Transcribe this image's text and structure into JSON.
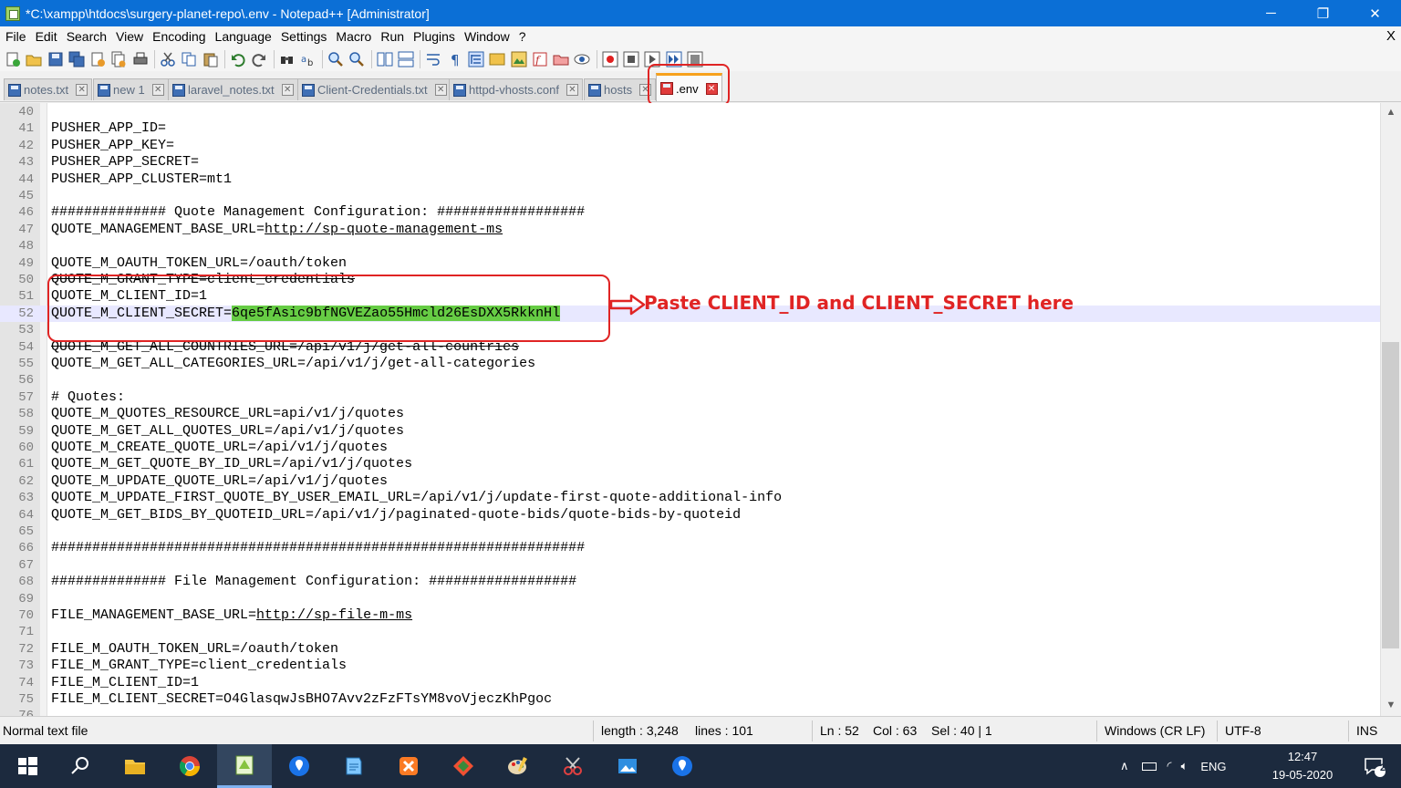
{
  "window": {
    "title": "*C:\\xampp\\htdocs\\surgery-planet-repo\\.env - Notepad++ [Administrator]",
    "minimize": "─",
    "maximize": "❐",
    "close": "✕"
  },
  "menu": {
    "items": [
      "File",
      "Edit",
      "Search",
      "View",
      "Encoding",
      "Language",
      "Settings",
      "Macro",
      "Run",
      "Plugins",
      "Window",
      "?"
    ],
    "close_label": "X"
  },
  "tabs": [
    {
      "label": "notes.txt",
      "active": false
    },
    {
      "label": "new 1",
      "active": false
    },
    {
      "label": "laravel_notes.txt",
      "active": false
    },
    {
      "label": "Client-Credentials.txt",
      "active": false
    },
    {
      "label": "httpd-vhosts.conf",
      "active": false
    },
    {
      "label": "hosts",
      "active": false
    },
    {
      "label": ".env",
      "active": true
    }
  ],
  "tab_close_glyph": "✕",
  "editor": {
    "lines": [
      {
        "n": "40",
        "text": ""
      },
      {
        "n": "41",
        "text": "PUSHER_APP_ID="
      },
      {
        "n": "42",
        "text": "PUSHER_APP_KEY="
      },
      {
        "n": "43",
        "text": "PUSHER_APP_SECRET="
      },
      {
        "n": "44",
        "text": "PUSHER_APP_CLUSTER=mt1"
      },
      {
        "n": "45",
        "text": ""
      },
      {
        "n": "46",
        "text": "############## Quote Management Configuration: ##################"
      },
      {
        "n": "47",
        "text": "QUOTE_MANAGEMENT_BASE_URL=",
        "url": "http://sp-quote-management-ms"
      },
      {
        "n": "48",
        "text": ""
      },
      {
        "n": "49",
        "text": "QUOTE_M_OAUTH_TOKEN_URL=/oauth/token"
      },
      {
        "n": "50",
        "text": "QUOTE_M_GRANT_TYPE=client_credentials",
        "strike": true
      },
      {
        "n": "51",
        "text": "QUOTE_M_CLIENT_ID=1"
      },
      {
        "n": "52",
        "text": "QUOTE_M_CLIENT_SECRET=",
        "selected": "6qe5fAsic9bfNGVEZao55Hmcld26EsDXX5RkknHl",
        "current": true
      },
      {
        "n": "53",
        "text": ""
      },
      {
        "n": "54",
        "text": "QUOTE_M_GET_ALL_COUNTRIES_URL=/api/v1/j/get-all-countries",
        "strike": true
      },
      {
        "n": "55",
        "text": "QUOTE_M_GET_ALL_CATEGORIES_URL=/api/v1/j/get-all-categories"
      },
      {
        "n": "56",
        "text": ""
      },
      {
        "n": "57",
        "text": "# Quotes:"
      },
      {
        "n": "58",
        "text": "QUOTE_M_QUOTES_RESOURCE_URL=api/v1/j/quotes"
      },
      {
        "n": "59",
        "text": "QUOTE_M_GET_ALL_QUOTES_URL=/api/v1/j/quotes"
      },
      {
        "n": "60",
        "text": "QUOTE_M_CREATE_QUOTE_URL=/api/v1/j/quotes"
      },
      {
        "n": "61",
        "text": "QUOTE_M_GET_QUOTE_BY_ID_URL=/api/v1/j/quotes"
      },
      {
        "n": "62",
        "text": "QUOTE_M_UPDATE_QUOTE_URL=/api/v1/j/quotes"
      },
      {
        "n": "63",
        "text": "QUOTE_M_UPDATE_FIRST_QUOTE_BY_USER_EMAIL_URL=/api/v1/j/update-first-quote-additional-info"
      },
      {
        "n": "64",
        "text": "QUOTE_M_GET_BIDS_BY_QUOTEID_URL=/api/v1/j/paginated-quote-bids/quote-bids-by-quoteid"
      },
      {
        "n": "65",
        "text": ""
      },
      {
        "n": "66",
        "text": "#################################################################"
      },
      {
        "n": "67",
        "text": ""
      },
      {
        "n": "68",
        "text": "############## File Management Configuration: ##################"
      },
      {
        "n": "69",
        "text": ""
      },
      {
        "n": "70",
        "text": "FILE_MANAGEMENT_BASE_URL=",
        "url": "http://sp-file-m-ms"
      },
      {
        "n": "71",
        "text": ""
      },
      {
        "n": "72",
        "text": "FILE_M_OAUTH_TOKEN_URL=/oauth/token"
      },
      {
        "n": "73",
        "text": "FILE_M_GRANT_TYPE=client_credentials"
      },
      {
        "n": "74",
        "text": "FILE_M_CLIENT_ID=1"
      },
      {
        "n": "75",
        "text": "FILE_M_CLIENT_SECRET=O4GlasqwJsBHO7Avv2zFzFTsYM8voVjeczKhPgoc"
      },
      {
        "n": "76",
        "text": ""
      }
    ]
  },
  "annotation": {
    "text": "Paste CLIENT_ID and CLIENT_SECRET here",
    "color": "#e02424"
  },
  "status": {
    "file_type": "Normal text file",
    "length": "length : 3,248",
    "lines": "lines : 101",
    "ln": "Ln : 52",
    "col": "Col : 63",
    "sel": "Sel : 40 | 1",
    "eol": "Windows (CR LF)",
    "encoding": "UTF-8",
    "mode": "INS"
  },
  "taskbar": {
    "apps": [
      "windows-start",
      "search",
      "file-explorer",
      "chrome",
      "notepad-plus-plus",
      "maps-pin",
      "notepad",
      "xampp",
      "git",
      "paint",
      "snipping-tool",
      "photos",
      "maps-pin"
    ],
    "language": "ENG",
    "time": "12:47",
    "date": "19-05-2020",
    "notifications": "2"
  },
  "colors": {
    "titlebar": "#0b6fd6",
    "selection": "#66cc44",
    "current_line": "#e8e8ff",
    "taskbar": "#1c2a3e",
    "active_tab_accent": "#f7a11c"
  }
}
